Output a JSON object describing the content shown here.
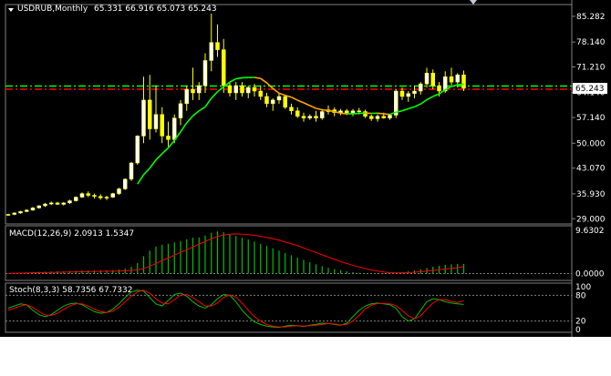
{
  "chart_data": [
    {
      "type": "candlestick",
      "symbol": "USDRUB",
      "timeframe": "Monthly",
      "title": "USDRUB,Monthly",
      "ohlc_label": "65.331 66.916 65.073 65.243",
      "price_ticks": [
        "85.282",
        "78.140",
        "71.210",
        "64.140",
        "57.140",
        "50.000",
        "43.070",
        "35.930",
        "29.000"
      ],
      "price_ticks_values": [
        85.282,
        78.14,
        71.21,
        64.14,
        57.14,
        50.0,
        43.07,
        35.93,
        29.0
      ],
      "ylim": [
        27.8,
        88.3
      ],
      "current_price": "65.243",
      "current_price_value": 65.243,
      "green_level": 65.9,
      "red_level": 65.0,
      "colors": {
        "bull": "#ffffff",
        "bear": "#ffff00",
        "wick": "#ffff00",
        "ma_up": "#00ff00",
        "ma_down": "#ffa500",
        "green_line": "#00ff00",
        "red_line": "#ff0000"
      },
      "candles": [
        [
          30.0,
          30.4,
          29.8,
          30.2
        ],
        [
          30.2,
          30.8,
          30.0,
          30.6
        ],
        [
          30.6,
          31.2,
          30.4,
          31.0
        ],
        [
          31.0,
          31.6,
          30.8,
          31.4
        ],
        [
          31.4,
          32.3,
          31.2,
          32.0
        ],
        [
          32.0,
          32.8,
          31.8,
          32.6
        ],
        [
          32.6,
          33.4,
          32.3,
          33.1
        ],
        [
          33.1,
          33.8,
          32.8,
          33.4
        ],
        [
          33.4,
          33.7,
          32.8,
          33.0
        ],
        [
          33.0,
          33.6,
          32.7,
          33.4
        ],
        [
          33.4,
          34.3,
          33.1,
          34.0
        ],
        [
          34.0,
          35.2,
          33.8,
          35.0
        ],
        [
          35.0,
          36.3,
          34.8,
          36.0
        ],
        [
          36.0,
          36.6,
          35.0,
          35.5
        ],
        [
          35.5,
          36.0,
          34.6,
          35.2
        ],
        [
          35.2,
          35.8,
          34.3,
          34.8
        ],
        [
          34.8,
          35.4,
          34.2,
          35.0
        ],
        [
          35.0,
          36.2,
          34.8,
          36.0
        ],
        [
          36.0,
          37.6,
          35.6,
          37.3
        ],
        [
          37.3,
          40.2,
          37.0,
          40.0
        ],
        [
          40.0,
          44.8,
          39.5,
          44.5
        ],
        [
          44.5,
          52.2,
          44.0,
          52.0
        ],
        [
          52.0,
          68.5,
          50.0,
          62.0
        ],
        [
          62.0,
          69.0,
          51.0,
          54.0
        ],
        [
          54.0,
          66.0,
          53.0,
          58.0
        ],
        [
          58.0,
          60.0,
          50.0,
          52.0
        ],
        [
          52.0,
          56.0,
          49.0,
          51.0
        ],
        [
          51.0,
          58.0,
          50.0,
          57.0
        ],
        [
          57.0,
          62.0,
          55.0,
          61.0
        ],
        [
          61.0,
          66.0,
          59.0,
          65.0
        ],
        [
          65.0,
          71.0,
          62.0,
          64.0
        ],
        [
          64.0,
          67.0,
          62.0,
          66.0
        ],
        [
          66.0,
          75.0,
          64.0,
          73.0
        ],
        [
          73.0,
          86.0,
          70.0,
          78.0
        ],
        [
          78.0,
          83.0,
          74.0,
          76.0
        ],
        [
          76.0,
          79.0,
          64.0,
          66.0
        ],
        [
          66.0,
          67.0,
          63.0,
          64.0
        ],
        [
          64.0,
          67.0,
          62.0,
          66.0
        ],
        [
          66.0,
          67.0,
          63.0,
          64.0
        ],
        [
          64.0,
          66.0,
          62.5,
          65.5
        ],
        [
          65.5,
          66.5,
          63.0,
          64.5
        ],
        [
          64.5,
          66.0,
          62.0,
          63.0
        ],
        [
          63.0,
          64.0,
          60.0,
          61.0
        ],
        [
          61.0,
          62.5,
          59.0,
          62.0
        ],
        [
          62.0,
          64.0,
          61.0,
          63.0
        ],
        [
          63.0,
          63.5,
          59.5,
          60.0
        ],
        [
          60.0,
          61.0,
          58.0,
          59.0
        ],
        [
          59.0,
          60.0,
          57.0,
          57.5
        ],
        [
          57.5,
          58.5,
          56.0,
          57.0
        ],
        [
          57.0,
          58.0,
          56.5,
          57.5
        ],
        [
          57.5,
          59.0,
          56.0,
          57.0
        ],
        [
          57.0,
          59.5,
          56.5,
          58.8
        ],
        [
          58.8,
          60.5,
          58.0,
          59.3
        ],
        [
          59.3,
          60.0,
          57.5,
          58.5
        ],
        [
          58.5,
          59.5,
          57.8,
          59.0
        ],
        [
          59.0,
          59.5,
          57.8,
          58.3
        ],
        [
          58.3,
          59.5,
          57.5,
          59.0
        ],
        [
          59.0,
          59.8,
          58.0,
          58.8
        ],
        [
          58.8,
          59.3,
          57.0,
          57.5
        ],
        [
          57.5,
          58.0,
          56.2,
          56.8
        ],
        [
          56.8,
          58.0,
          56.0,
          57.5
        ],
        [
          57.5,
          58.5,
          56.8,
          57.0
        ],
        [
          57.0,
          58.0,
          56.5,
          57.8
        ],
        [
          57.8,
          65.0,
          57.0,
          64.5
        ],
        [
          64.5,
          65.5,
          62.0,
          63.0
        ],
        [
          63.0,
          64.5,
          61.5,
          63.8
        ],
        [
          63.8,
          66.0,
          62.5,
          64.5
        ],
        [
          64.5,
          67.0,
          63.5,
          66.5
        ],
        [
          66.5,
          71.0,
          65.5,
          69.5
        ],
        [
          69.5,
          70.5,
          65.0,
          66.0
        ],
        [
          66.0,
          67.0,
          63.0,
          64.5
        ],
        [
          64.5,
          70.0,
          64.0,
          68.5
        ],
        [
          68.5,
          71.0,
          66.0,
          67.0
        ],
        [
          67.0,
          69.5,
          65.5,
          69.0
        ],
        [
          69.0,
          70.2,
          64.5,
          65.3
        ]
      ],
      "macd": {
        "label": "MACD(12,26,9) 2.0913 1.5347",
        "ticks": [
          "9.6302",
          "0.0000"
        ],
        "histogram": [
          0.1,
          0.15,
          0.2,
          0.25,
          0.3,
          0.35,
          0.4,
          0.45,
          0.5,
          0.5,
          0.55,
          0.6,
          0.65,
          0.7,
          0.7,
          0.7,
          0.7,
          0.75,
          0.85,
          1.05,
          1.5,
          2.3,
          3.8,
          5.0,
          5.9,
          6.3,
          6.5,
          6.8,
          7.1,
          7.5,
          7.8,
          7.9,
          8.3,
          8.9,
          9.2,
          9.0,
          8.6,
          8.2,
          7.8,
          7.4,
          7.0,
          6.5,
          6.0,
          5.5,
          5.0,
          4.5,
          4.0,
          3.5,
          3.0,
          2.5,
          2.0,
          1.6,
          1.3,
          1.0,
          0.75,
          0.5,
          0.3,
          0.15,
          0.05,
          -0.05,
          -0.1,
          -0.1,
          -0.05,
          0.1,
          0.3,
          0.5,
          0.7,
          0.9,
          1.2,
          1.5,
          1.7,
          1.9,
          2.0,
          2.1,
          2.09
        ],
        "signal": [
          0.05,
          0.08,
          0.1,
          0.13,
          0.16,
          0.19,
          0.22,
          0.25,
          0.28,
          0.31,
          0.34,
          0.37,
          0.4,
          0.43,
          0.46,
          0.49,
          0.51,
          0.53,
          0.56,
          0.6,
          0.68,
          0.8,
          1.1,
          1.6,
          2.2,
          2.8,
          3.4,
          4.0,
          4.6,
          5.2,
          5.8,
          6.4,
          7.0,
          7.6,
          8.1,
          8.4,
          8.6,
          8.65,
          8.6,
          8.5,
          8.35,
          8.15,
          7.9,
          7.6,
          7.3,
          6.9,
          6.5,
          6.1,
          5.6,
          5.1,
          4.6,
          4.1,
          3.6,
          3.1,
          2.6,
          2.2,
          1.8,
          1.45,
          1.1,
          0.8,
          0.55,
          0.35,
          0.2,
          0.15,
          0.15,
          0.2,
          0.3,
          0.42,
          0.55,
          0.7,
          0.85,
          1.0,
          1.15,
          1.3,
          1.53
        ]
      },
      "stoch": {
        "label": "Stoch(8,3,3) 58.7356 67.7332",
        "ticks": [
          "100",
          "80",
          "20",
          "0"
        ],
        "k": [
          50,
          55,
          60,
          58,
          45,
          35,
          30,
          35,
          45,
          55,
          60,
          62,
          58,
          50,
          42,
          38,
          40,
          48,
          60,
          75,
          88,
          92,
          90,
          75,
          60,
          55,
          68,
          82,
          85,
          78,
          65,
          55,
          50,
          58,
          72,
          82,
          80,
          65,
          45,
          30,
          18,
          12,
          8,
          6,
          5,
          8,
          10,
          9,
          7,
          10,
          12,
          15,
          14,
          12,
          10,
          15,
          30,
          45,
          55,
          60,
          62,
          60,
          58,
          50,
          30,
          20,
          25,
          45,
          65,
          72,
          70,
          65,
          62,
          60,
          58.7
        ],
        "d": [
          45,
          50,
          55,
          58,
          52,
          42,
          34,
          33,
          38,
          47,
          55,
          60,
          60,
          55,
          48,
          42,
          40,
          43,
          52,
          65,
          78,
          88,
          92,
          85,
          72,
          62,
          60,
          70,
          80,
          82,
          75,
          65,
          55,
          55,
          62,
          75,
          81,
          76,
          62,
          45,
          30,
          20,
          12,
          8,
          6,
          6,
          8,
          9,
          8,
          9,
          10,
          12,
          14,
          13,
          11,
          12,
          20,
          33,
          48,
          57,
          61,
          61,
          60,
          56,
          45,
          32,
          25,
          32,
          48,
          62,
          70,
          70,
          66,
          63,
          67.7
        ]
      }
    }
  ],
  "toolbar": {
    "dropdown_icon": "triangle-down-icon",
    "corner_icon": "triangle-down-icon"
  }
}
